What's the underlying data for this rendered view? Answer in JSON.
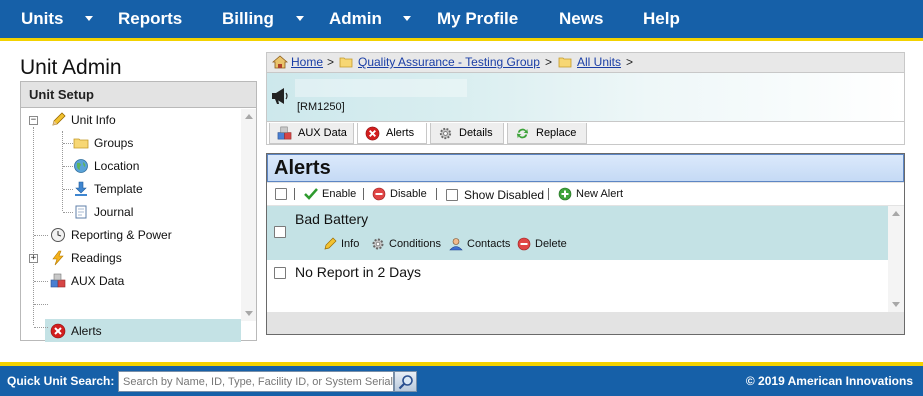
{
  "nav": {
    "units": "Units",
    "reports": "Reports",
    "billing": "Billing",
    "admin": "Admin",
    "my_profile": "My Profile",
    "news": "News",
    "help": "Help"
  },
  "page": {
    "title": "Unit Admin"
  },
  "sidebar": {
    "header": "Unit Setup",
    "items": [
      {
        "label": "Unit Info",
        "icon": "pencil-icon"
      },
      {
        "label": "Groups",
        "icon": "folder-icon"
      },
      {
        "label": "Location",
        "icon": "globe-icon"
      },
      {
        "label": "Template",
        "icon": "download-arrow-icon"
      },
      {
        "label": "Journal",
        "icon": "journal-icon"
      },
      {
        "label": "Reporting & Power",
        "icon": "clock-icon"
      },
      {
        "label": "Readings",
        "icon": "lightning-icon"
      },
      {
        "label": "AUX Data",
        "icon": "cubes-icon"
      },
      {
        "label": "Alerts",
        "icon": "red-x-icon"
      }
    ],
    "selected": "Alerts"
  },
  "breadcrumb": {
    "home": "Home",
    "group": "Quality Assurance - Testing Group",
    "all_units": "All Units",
    "sep": ">"
  },
  "unit": {
    "id": "[RM1250]"
  },
  "tabs": [
    {
      "label": "AUX Data",
      "icon": "cubes-icon"
    },
    {
      "label": "Alerts",
      "icon": "red-x-icon"
    },
    {
      "label": "Details",
      "icon": "gear-icon"
    },
    {
      "label": "Replace",
      "icon": "recycle-icon"
    }
  ],
  "alerts_panel": {
    "title": "Alerts",
    "toolbar": {
      "enable": "Enable",
      "disable": "Disable",
      "show_disabled": "Show Disabled",
      "new_alert": "New Alert"
    },
    "alerts": [
      {
        "name": "Bad Battery",
        "expanded": true,
        "actions": [
          "Info",
          "Conditions",
          "Contacts",
          "Delete"
        ]
      },
      {
        "name": "No Report in 2 Days",
        "expanded": false
      }
    ]
  },
  "footer": {
    "quick_search_label": "Quick Unit Search:",
    "quick_search_placeholder": "Search by Name, ID, Type, Facility ID, or System Serial",
    "copyright": "© 2019 American Innovations"
  },
  "colors": {
    "nav_bg": "#1660a8",
    "accent_stripe": "#f3d200",
    "selected_row": "#c4e2e5",
    "link": "#1a3ea6"
  }
}
